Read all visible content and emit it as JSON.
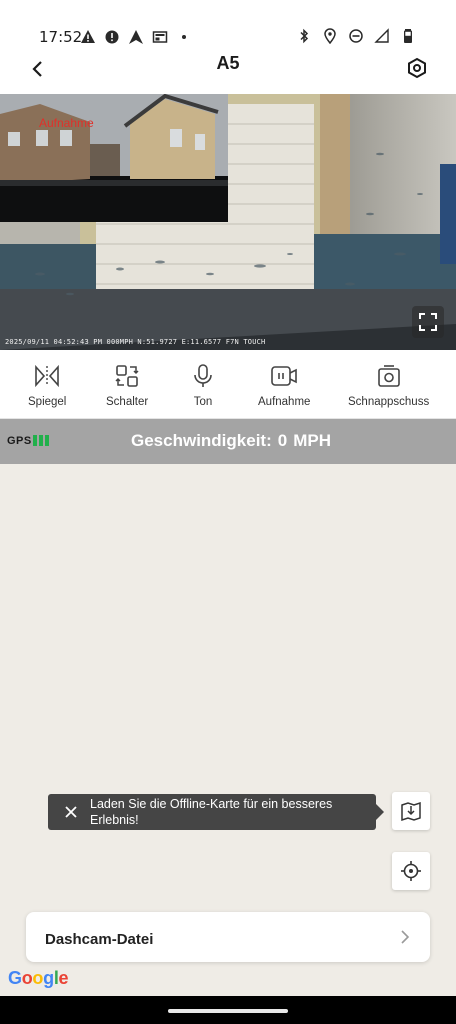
{
  "status_bar": {
    "time": "17:52",
    "left_icons": [
      "warning-icon",
      "alert-icon",
      "navigation-icon",
      "news-icon",
      "dot-icon"
    ],
    "right_icons": [
      "bluetooth-icon",
      "location-icon",
      "do-not-disturb-icon",
      "signal-icon",
      "battery-icon"
    ]
  },
  "app_bar": {
    "title": "A5"
  },
  "video": {
    "pip_label": "Aufnahme",
    "osd_text": "2025/09/11 04:52:43 PM 000MPH N:51.9727 E:11.6577 F7N TOUCH"
  },
  "toolbar": {
    "items": [
      {
        "label": "Spiegel",
        "icon": "mirror-icon"
      },
      {
        "label": "Schalter",
        "icon": "switch-camera-icon"
      },
      {
        "label": "Ton",
        "icon": "microphone-icon"
      },
      {
        "label": "Aufnahme",
        "icon": "record-icon"
      },
      {
        "label": "Schnappschuss",
        "icon": "snapshot-icon"
      }
    ]
  },
  "speed_bar": {
    "gps_label": "GPS",
    "speed_label": "Geschwindigkeit:",
    "speed_value": "0",
    "speed_unit": "MPH"
  },
  "map": {
    "toast_text": "Laden Sie die Offline-Karte für ein besseres Erlebnis!",
    "file_card_label": "Dashcam-Datei",
    "google_letters": [
      "G",
      "o",
      "o",
      "g",
      "l",
      "e"
    ]
  },
  "colors": {
    "accent_gps": "#21b04b",
    "speed_bar": "#a4a4a4",
    "map_bg": "#efece6",
    "pip_label": "#e0302a"
  }
}
